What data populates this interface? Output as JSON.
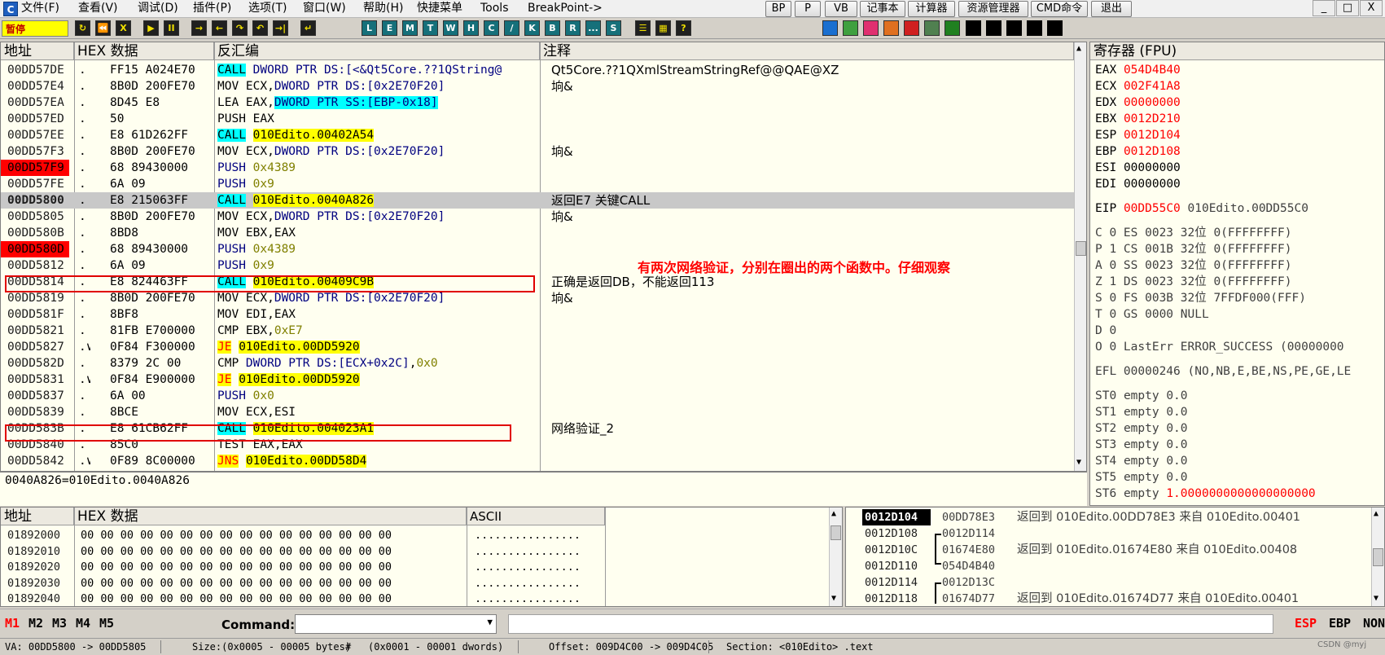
{
  "app": {
    "icon_letter": "C",
    "menu": [
      "文件(F)",
      "查看(V)",
      "调试(D)",
      "插件(P)",
      "选项(T)",
      "窗口(W)",
      "帮助(H)",
      "快捷菜单",
      "Tools",
      "BreakPoint->"
    ],
    "quick_buttons": [
      "BP",
      "P",
      "VB",
      "记事本",
      "计算器",
      "资源管理器",
      "CMD命令",
      "退出"
    ],
    "window_buttons": [
      "_",
      "□",
      "X"
    ]
  },
  "toolbar": {
    "status": "暂停",
    "buttons_a": [
      "↻",
      "⏪",
      "X",
      "▶",
      "II",
      "→",
      "←",
      "↷",
      "↶",
      "→|",
      "↵"
    ],
    "letter_buttons": [
      "L",
      "E",
      "M",
      "T",
      "W",
      "H",
      "C",
      "/",
      "K",
      "B",
      "R",
      "...",
      "S"
    ],
    "buttons_b": [
      "☰",
      "▦",
      "?"
    ]
  },
  "cpu": {
    "headers": {
      "addr": "地址",
      "hex": "HEX 数据",
      "asm": "反汇编",
      "comment": "注释"
    },
    "rows": [
      {
        "addr": "00DD57DE",
        "mark": ".",
        "hex": "FF15 A024E70",
        "asm_parts": [
          [
            "CALL",
            "cy"
          ],
          [
            " DWORD PTR DS:[<&Qt5Core.??1QString@",
            "blue"
          ]
        ],
        "comment": "Qt5Core.??1QXmlStreamStringRef@@QAE@XZ"
      },
      {
        "addr": "00DD57E4",
        "mark": ".",
        "hex": "8B0D 200FE70",
        "asm_parts": [
          [
            "MOV ECX,",
            ""
          ],
          [
            "DWORD PTR DS:[0x2E70F20]",
            "blue"
          ]
        ],
        "comment": "垧&"
      },
      {
        "addr": "00DD57EA",
        "mark": ".",
        "hex": "8D45 E8",
        "asm_parts": [
          [
            "LEA EAX,",
            ""
          ],
          [
            "DWORD PTR SS:[EBP-0x18]",
            "cyblue"
          ]
        ],
        "comment": ""
      },
      {
        "addr": "00DD57ED",
        "mark": ".",
        "hex": "50",
        "asm_parts": [
          [
            "PUSH EAX",
            ""
          ]
        ],
        "comment": ""
      },
      {
        "addr": "00DD57EE",
        "mark": ".",
        "hex": "E8 61D262FF",
        "asm_parts": [
          [
            "CALL",
            "cy"
          ],
          [
            " ",
            ""
          ],
          [
            "010Edito.00402A54",
            "ye"
          ]
        ],
        "comment": ""
      },
      {
        "addr": "00DD57F3",
        "mark": ".",
        "hex": "8B0D 200FE70",
        "asm_parts": [
          [
            "MOV ECX,",
            ""
          ],
          [
            "DWORD PTR DS:[0x2E70F20]",
            "blue"
          ]
        ],
        "comment": "垧&"
      },
      {
        "addr": "00DD57F9",
        "mark": ".",
        "hex": "68 89430000",
        "asm_parts": [
          [
            "PUSH ",
            "blue"
          ],
          [
            "0x4389",
            "olive"
          ]
        ],
        "comment": "",
        "addr_red": true
      },
      {
        "addr": "00DD57FE",
        "mark": ".",
        "hex": "6A 09",
        "asm_parts": [
          [
            "PUSH ",
            "blue"
          ],
          [
            "0x9",
            "olive"
          ]
        ],
        "comment": ""
      },
      {
        "addr": "00DD5800",
        "mark": ".",
        "hex": "E8 215063FF",
        "asm_parts": [
          [
            "CALL",
            "cy"
          ],
          [
            " ",
            ""
          ],
          [
            "010Edito.0040A826",
            "ye"
          ]
        ],
        "comment": "返回E7 关键CALL",
        "selected": true
      },
      {
        "addr": "00DD5805",
        "mark": ".",
        "hex": "8B0D 200FE70",
        "asm_parts": [
          [
            "MOV ECX,",
            ""
          ],
          [
            "DWORD PTR DS:[0x2E70F20]",
            "blue"
          ]
        ],
        "comment": "垧&"
      },
      {
        "addr": "00DD580B",
        "mark": ".",
        "hex": "8BD8",
        "asm_parts": [
          [
            "MOV EBX,EAX",
            ""
          ]
        ],
        "comment": ""
      },
      {
        "addr": "00DD580D",
        "mark": ".",
        "hex": "68 89430000",
        "asm_parts": [
          [
            "PUSH ",
            "blue"
          ],
          [
            "0x4389",
            "olive"
          ]
        ],
        "comment": "",
        "addr_red": true
      },
      {
        "addr": "00DD5812",
        "mark": ".",
        "hex": "6A 09",
        "asm_parts": [
          [
            "PUSH ",
            "blue"
          ],
          [
            "0x9",
            "olive"
          ]
        ],
        "comment": ""
      },
      {
        "addr": "00DD5814",
        "mark": ".",
        "hex": "E8 824463FF",
        "asm_parts": [
          [
            "CALL",
            "cy"
          ],
          [
            " ",
            ""
          ],
          [
            "010Edito.00409C9B",
            "ye"
          ]
        ],
        "comment": "正确是返回DB，不能返回113",
        "boxed": true
      },
      {
        "addr": "00DD5819",
        "mark": ".",
        "hex": "8B0D 200FE70",
        "asm_parts": [
          [
            "MOV ECX,",
            ""
          ],
          [
            "DWORD PTR DS:[0x2E70F20]",
            "blue"
          ]
        ],
        "comment": "垧&"
      },
      {
        "addr": "00DD581F",
        "mark": ".",
        "hex": "8BF8",
        "asm_parts": [
          [
            "MOV EDI,EAX",
            ""
          ]
        ],
        "comment": ""
      },
      {
        "addr": "00DD5821",
        "mark": ".",
        "hex": "81FB E700000",
        "asm_parts": [
          [
            "CMP EBX,",
            ""
          ],
          [
            "0xE7",
            "olive"
          ]
        ],
        "comment": ""
      },
      {
        "addr": "00DD5827",
        "mark": ".∨",
        "hex": "0F84 F300000",
        "asm_parts": [
          [
            "JE",
            "yer"
          ],
          [
            " ",
            ""
          ],
          [
            "010Edito.00DD5920",
            "ye"
          ]
        ],
        "comment": ""
      },
      {
        "addr": "00DD582D",
        "mark": ".",
        "hex": "8379 2C 00",
        "asm_parts": [
          [
            "CMP ",
            ""
          ],
          [
            "DWORD PTR DS:[ECX+0x2C]",
            "blue"
          ],
          [
            ",",
            ""
          ],
          [
            "0x0",
            "olive"
          ]
        ],
        "comment": ""
      },
      {
        "addr": "00DD5831",
        "mark": ".∨",
        "hex": "0F84 E900000",
        "asm_parts": [
          [
            "JE",
            "yer"
          ],
          [
            " ",
            ""
          ],
          [
            "010Edito.00DD5920",
            "ye"
          ]
        ],
        "comment": ""
      },
      {
        "addr": "00DD5837",
        "mark": ".",
        "hex": "6A 00",
        "asm_parts": [
          [
            "PUSH ",
            "blue"
          ],
          [
            "0x0",
            "olive"
          ]
        ],
        "comment": ""
      },
      {
        "addr": "00DD5839",
        "mark": ".",
        "hex": "8BCE",
        "asm_parts": [
          [
            "MOV ECX,ESI",
            ""
          ]
        ],
        "comment": ""
      },
      {
        "addr": "00DD583B",
        "mark": ".",
        "hex": "E8 61CB62FF",
        "asm_parts": [
          [
            "CALL",
            "cy"
          ],
          [
            " ",
            ""
          ],
          [
            "010Edito.004023A1",
            "ye"
          ]
        ],
        "comment": "网络验证_2",
        "boxed": true
      },
      {
        "addr": "00DD5840",
        "mark": ".",
        "hex": "85C0",
        "asm_parts": [
          [
            "TEST EAX,EAX",
            ""
          ]
        ],
        "comment": ""
      },
      {
        "addr": "00DD5842",
        "mark": ".∨",
        "hex": "0F89 8C00000",
        "asm_parts": [
          [
            "JNS",
            "yer"
          ],
          [
            " ",
            ""
          ],
          [
            "010Edito.00DD58D4",
            "ye"
          ]
        ],
        "comment": ""
      }
    ],
    "annotation": "有两次网络验证，分别在圈出的两个函数中。仔细观察",
    "info_line": "0040A826=010Edito.0040A826"
  },
  "registers": {
    "header": "寄存器 (FPU)",
    "regs": [
      {
        "name": "EAX",
        "value": "054D4B40",
        "changed": true,
        "extra": ""
      },
      {
        "name": "ECX",
        "value": "002F41A8",
        "changed": true,
        "extra": ""
      },
      {
        "name": "EDX",
        "value": "00000000",
        "changed": true,
        "extra": ""
      },
      {
        "name": "EBX",
        "value": "0012D210",
        "changed": true,
        "extra": ""
      },
      {
        "name": "ESP",
        "value": "0012D104",
        "changed": true,
        "extra": ""
      },
      {
        "name": "EBP",
        "value": "0012D108",
        "changed": true,
        "extra": ""
      },
      {
        "name": "ESI",
        "value": "00000000",
        "changed": false,
        "extra": ""
      },
      {
        "name": "EDI",
        "value": "00000000",
        "changed": false,
        "extra": ""
      }
    ],
    "eip": {
      "name": "EIP",
      "value": "00DD55C0",
      "extra": "010Edito.00DD55C0"
    },
    "flags": [
      "C 0  ES 0023 32位 0(FFFFFFFF)",
      "P 1  CS 001B 32位 0(FFFFFFFF)",
      "A 0  SS 0023 32位 0(FFFFFFFF)",
      "Z 1  DS 0023 32位 0(FFFFFFFF)",
      "S 0  FS 003B 32位 7FFDF000(FFF)",
      "T 0  GS 0000 NULL",
      "D 0",
      "O 0  LastErr ERROR_SUCCESS (00000000"
    ],
    "efl": "EFL 00000246 (NO,NB,E,BE,NS,PE,GE,LE",
    "fpu": [
      {
        "name": "ST0",
        "text": "empty 0.0",
        "red": ""
      },
      {
        "name": "ST1",
        "text": "empty 0.0",
        "red": ""
      },
      {
        "name": "ST2",
        "text": "empty 0.0",
        "red": ""
      },
      {
        "name": "ST3",
        "text": "empty 0.0",
        "red": ""
      },
      {
        "name": "ST4",
        "text": "empty 0.0",
        "red": ""
      },
      {
        "name": "ST5",
        "text": "empty 0.0",
        "red": ""
      },
      {
        "name": "ST6",
        "text": "empty ",
        "red": "1.0000000000000000000"
      }
    ]
  },
  "dump": {
    "headers": {
      "addr": "地址",
      "hex": "HEX 数据",
      "ascii": "ASCII"
    },
    "rows": [
      {
        "addr": "01892000",
        "hex": "00 00 00 00 00 00 00 00 00 00 00 00 00 00 00 00",
        "ascii": "................"
      },
      {
        "addr": "01892010",
        "hex": "00 00 00 00 00 00 00 00 00 00 00 00 00 00 00 00",
        "ascii": "................"
      },
      {
        "addr": "01892020",
        "hex": "00 00 00 00 00 00 00 00 00 00 00 00 00 00 00 00",
        "ascii": "................"
      },
      {
        "addr": "01892030",
        "hex": "00 00 00 00 00 00 00 00 00 00 00 00 00 00 00 00",
        "ascii": "................"
      },
      {
        "addr": "01892040",
        "hex": "00 00 00 00 00 00 00 00 00 00 00 00 00 00 00 00",
        "ascii": "................"
      }
    ]
  },
  "stack": {
    "rows": [
      {
        "addr": "0012D104",
        "value": "00DD78E3",
        "comment": "返回到 010Edito.00DD78E3 来自 010Edito.00401",
        "selected": true
      },
      {
        "addr": "0012D108",
        "value": "0012D114",
        "comment": ""
      },
      {
        "addr": "0012D10C",
        "value": "01674E80",
        "comment": "返回到 010Edito.01674E80 来自 010Edito.00408"
      },
      {
        "addr": "0012D110",
        "value": "054D4B40",
        "comment": ""
      },
      {
        "addr": "0012D114",
        "value": "0012D13C",
        "comment": ""
      },
      {
        "addr": "0012D118",
        "value": "01674D77",
        "comment": "返回到 010Edito.01674D77 来自 010Edito.00401"
      }
    ]
  },
  "cmdbar": {
    "tabs": [
      "M1",
      "M2",
      "M3",
      "M4",
      "M5"
    ],
    "command_label": "Command:",
    "right_labels": [
      "ESP",
      "EBP",
      "NON"
    ]
  },
  "statusbar": {
    "va": "VA: 00DD5800 -> 00DD5805",
    "size": "Size:(0x0005 - 00005 bytes)",
    "hash": "#",
    "dwords": "(0x0001 - 00001 dwords)",
    "offset": "Offset: 009D4C00 -> 009D4C05",
    "section": "Section: <010Edito> .text",
    "watermark": "CSDN @myj"
  },
  "colors": {
    "highlight_cyan": "#00ffff",
    "highlight_yellow": "#ffff00",
    "changed_red": "#ff0000",
    "address_red": "#ff0000"
  }
}
